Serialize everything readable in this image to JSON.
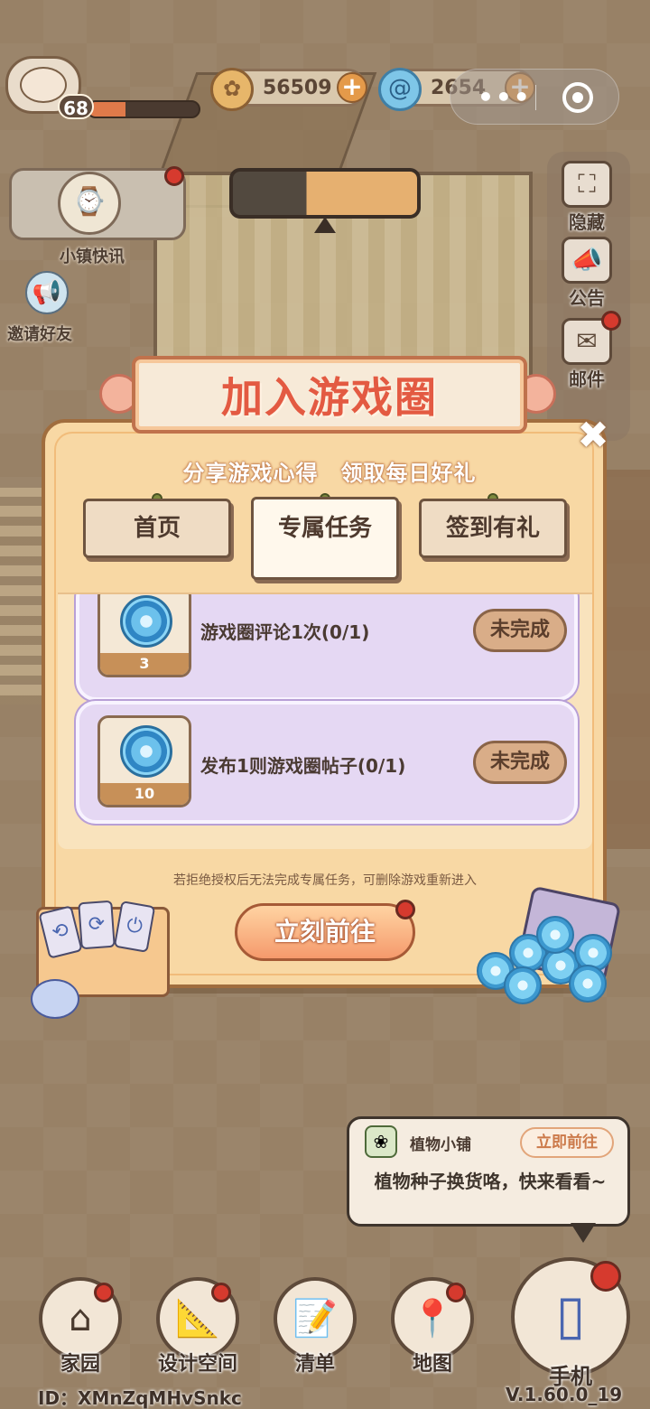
{
  "header": {
    "level": "68",
    "xp_progress_percent": 34,
    "coins": "56509",
    "gems": "2654",
    "capsule_menu": "•••"
  },
  "left_widgets": {
    "news_label": "小镇快讯",
    "invite_label": "邀请好友"
  },
  "right_panel": {
    "hide_label": "隐藏",
    "announce_label": "公告",
    "mail_label": "邮件"
  },
  "modal": {
    "title": "加入游戏圈",
    "subtitle": "分享游戏心得　领取每日好礼",
    "tabs": [
      {
        "label": "首页",
        "active": false
      },
      {
        "label": "专属任务",
        "active": true
      },
      {
        "label": "签到有礼",
        "active": false
      }
    ],
    "tasks": [
      {
        "reward_count": "3",
        "text": "游戏圈评论1次(0/1)",
        "status": "未完成"
      },
      {
        "reward_count": "10",
        "text": "发布1则游戏圈帖子(0/1)",
        "status": "未完成"
      }
    ],
    "note": "若拒绝授权后无法完成专属任务，可删除游戏重新进入",
    "go_button": "立刻前往",
    "close_symbol": "✖"
  },
  "tooltip": {
    "title": "植物小铺",
    "go": "立即前往",
    "body": "植物种子换货咯，快来看看~"
  },
  "bottom_nav": [
    {
      "label": "家园",
      "icon": "house-icon"
    },
    {
      "label": "设计空间",
      "icon": "design-icon"
    },
    {
      "label": "清单",
      "icon": "list-icon"
    },
    {
      "label": "地图",
      "icon": "map-pin-icon"
    }
  ],
  "phone_label": "手机",
  "footer": {
    "id": "ID：XMnZqMHvSnkc",
    "version": "V.1.60.0_19"
  },
  "colors": {
    "accent_red": "#e35a42",
    "modal_bg": "#f8d8a4",
    "task_card_bg": "#e5d8f3"
  }
}
